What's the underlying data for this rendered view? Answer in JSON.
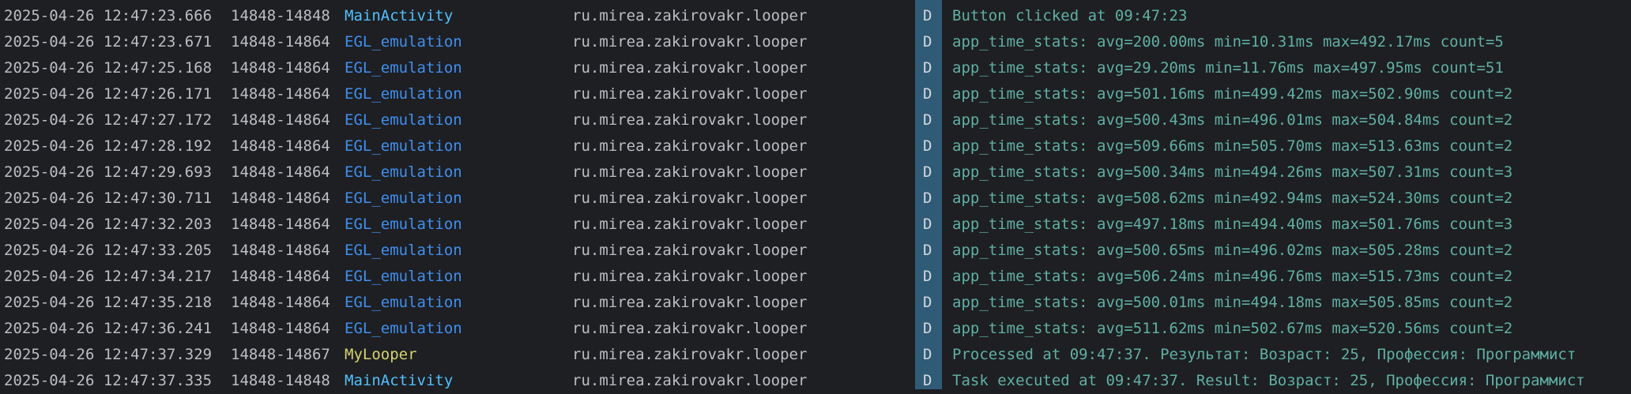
{
  "colors": {
    "background": "#1e1f22",
    "text": "#bcbec4",
    "tag_main_activity": "#4fc1ff",
    "tag_egl_emulation": "#3f8ff0",
    "tag_my_looper": "#d7d36f",
    "message_debug": "#5fb0a5",
    "level_stripe": "#2f5b77"
  },
  "log": {
    "rows": [
      {
        "timestamp": "2025-04-26 12:47:23.666",
        "pid_tid": "14848-14848",
        "tag": "MainActivity",
        "tag_color": "#4fc1ff",
        "package": "ru.mirea.zakirovakr.looper",
        "level": "D",
        "message": "Button clicked at 09:47:23"
      },
      {
        "timestamp": "2025-04-26 12:47:23.671",
        "pid_tid": "14848-14864",
        "tag": "EGL_emulation",
        "tag_color": "#3f8ff0",
        "package": "ru.mirea.zakirovakr.looper",
        "level": "D",
        "message": "app_time_stats: avg=200.00ms min=10.31ms max=492.17ms count=5"
      },
      {
        "timestamp": "2025-04-26 12:47:25.168",
        "pid_tid": "14848-14864",
        "tag": "EGL_emulation",
        "tag_color": "#3f8ff0",
        "package": "ru.mirea.zakirovakr.looper",
        "level": "D",
        "message": "app_time_stats: avg=29.20ms min=11.76ms max=497.95ms count=51"
      },
      {
        "timestamp": "2025-04-26 12:47:26.171",
        "pid_tid": "14848-14864",
        "tag": "EGL_emulation",
        "tag_color": "#3f8ff0",
        "package": "ru.mirea.zakirovakr.looper",
        "level": "D",
        "message": "app_time_stats: avg=501.16ms min=499.42ms max=502.90ms count=2"
      },
      {
        "timestamp": "2025-04-26 12:47:27.172",
        "pid_tid": "14848-14864",
        "tag": "EGL_emulation",
        "tag_color": "#3f8ff0",
        "package": "ru.mirea.zakirovakr.looper",
        "level": "D",
        "message": "app_time_stats: avg=500.43ms min=496.01ms max=504.84ms count=2"
      },
      {
        "timestamp": "2025-04-26 12:47:28.192",
        "pid_tid": "14848-14864",
        "tag": "EGL_emulation",
        "tag_color": "#3f8ff0",
        "package": "ru.mirea.zakirovakr.looper",
        "level": "D",
        "message": "app_time_stats: avg=509.66ms min=505.70ms max=513.63ms count=2"
      },
      {
        "timestamp": "2025-04-26 12:47:29.693",
        "pid_tid": "14848-14864",
        "tag": "EGL_emulation",
        "tag_color": "#3f8ff0",
        "package": "ru.mirea.zakirovakr.looper",
        "level": "D",
        "message": "app_time_stats: avg=500.34ms min=494.26ms max=507.31ms count=3"
      },
      {
        "timestamp": "2025-04-26 12:47:30.711",
        "pid_tid": "14848-14864",
        "tag": "EGL_emulation",
        "tag_color": "#3f8ff0",
        "package": "ru.mirea.zakirovakr.looper",
        "level": "D",
        "message": "app_time_stats: avg=508.62ms min=492.94ms max=524.30ms count=2"
      },
      {
        "timestamp": "2025-04-26 12:47:32.203",
        "pid_tid": "14848-14864",
        "tag": "EGL_emulation",
        "tag_color": "#3f8ff0",
        "package": "ru.mirea.zakirovakr.looper",
        "level": "D",
        "message": "app_time_stats: avg=497.18ms min=494.40ms max=501.76ms count=3"
      },
      {
        "timestamp": "2025-04-26 12:47:33.205",
        "pid_tid": "14848-14864",
        "tag": "EGL_emulation",
        "tag_color": "#3f8ff0",
        "package": "ru.mirea.zakirovakr.looper",
        "level": "D",
        "message": "app_time_stats: avg=500.65ms min=496.02ms max=505.28ms count=2"
      },
      {
        "timestamp": "2025-04-26 12:47:34.217",
        "pid_tid": "14848-14864",
        "tag": "EGL_emulation",
        "tag_color": "#3f8ff0",
        "package": "ru.mirea.zakirovakr.looper",
        "level": "D",
        "message": "app_time_stats: avg=506.24ms min=496.76ms max=515.73ms count=2"
      },
      {
        "timestamp": "2025-04-26 12:47:35.218",
        "pid_tid": "14848-14864",
        "tag": "EGL_emulation",
        "tag_color": "#3f8ff0",
        "package": "ru.mirea.zakirovakr.looper",
        "level": "D",
        "message": "app_time_stats: avg=500.01ms min=494.18ms max=505.85ms count=2"
      },
      {
        "timestamp": "2025-04-26 12:47:36.241",
        "pid_tid": "14848-14864",
        "tag": "EGL_emulation",
        "tag_color": "#3f8ff0",
        "package": "ru.mirea.zakirovakr.looper",
        "level": "D",
        "message": "app_time_stats: avg=511.62ms min=502.67ms max=520.56ms count=2"
      },
      {
        "timestamp": "2025-04-26 12:47:37.329",
        "pid_tid": "14848-14867",
        "tag": "MyLooper",
        "tag_color": "#d7d36f",
        "package": "ru.mirea.zakirovakr.looper",
        "level": "D",
        "message": "Processed at 09:47:37. Результат: Возраст: 25, Профессия: Программист"
      },
      {
        "timestamp": "2025-04-26 12:47:37.335",
        "pid_tid": "14848-14848",
        "tag": "MainActivity",
        "tag_color": "#4fc1ff",
        "package": "ru.mirea.zakirovakr.looper",
        "level": "D",
        "message": "Task executed at 09:47:37. Result: Возраст: 25, Профессия: Программист"
      }
    ]
  }
}
